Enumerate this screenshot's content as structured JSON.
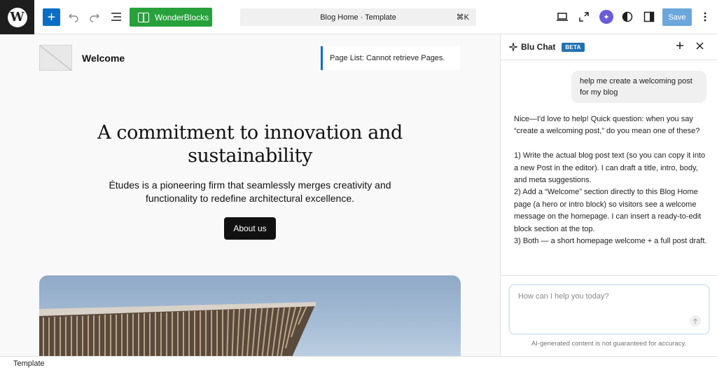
{
  "toolbar": {
    "wp_logo_letter": "W",
    "add_symbol": "+",
    "wonderblocks_label": "WonderBlocks",
    "command_bar_title": "Blog Home · Template",
    "command_shortcut": "⌘K",
    "save_label": "Save"
  },
  "site": {
    "title": "Welcome",
    "page_list_notice": "Page List: Cannot retrieve Pages.",
    "hero_title": "A commitment to innovation and sustainability",
    "hero_subtitle": "Études is a pioneering firm that seamlessly merges creativity and functionality to redefine architectural excellence.",
    "about_button": "About us"
  },
  "status_bar": {
    "label": "Template"
  },
  "chat": {
    "title": "Blu Chat",
    "badge": "BETA",
    "user_message": "help me create a welcoming post for my blog",
    "assistant_intro": "Nice—I'd love to help! Quick question: when you say “create a welcoming post,” do you mean one of these?",
    "assistant_options": [
      "1) Write the actual blog post text (so you can copy it into a new Post in the editor). I can draft a title, intro, body, and meta suggestions.",
      "2) Add a “Welcome” section directly to this Blog Home page (a hero or intro block) so visitors see a welcome message on the homepage. I can insert a ready-to-edit block section at the top.",
      "3) Both — a short homepage welcome + a full post draft."
    ],
    "input_placeholder": "How can I help you today?",
    "disclaimer": "AI-generated content is not guaranteed for accuracy."
  },
  "colors": {
    "accent_blue": "#0b6ec5",
    "wonderblocks_green": "#27a13b",
    "ai_purple": "#6b5cd6",
    "dark": "#1e1e1e"
  },
  "icons": [
    "wordpress-logo-icon",
    "plus-icon",
    "undo-icon",
    "redo-icon",
    "document-overview-icon",
    "wonderblocks-icon",
    "desktop-preview-icon",
    "external-view-icon",
    "ai-sparkle-icon",
    "styles-contrast-icon",
    "sidebar-toggle-icon",
    "more-options-icon",
    "sparkle-icon",
    "close-icon",
    "send-arrow-icon"
  ]
}
